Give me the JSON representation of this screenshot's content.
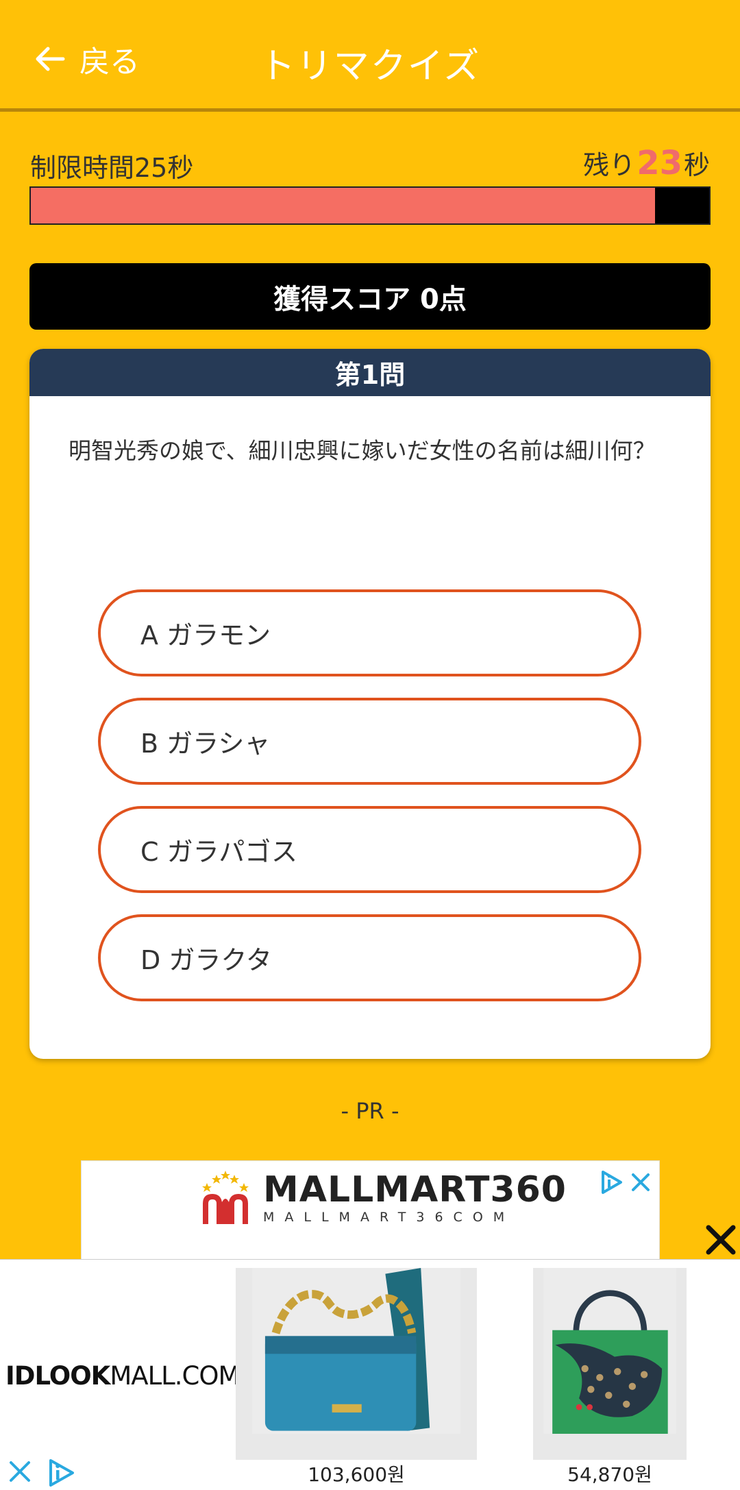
{
  "header": {
    "back_label": "戻る",
    "title": "トリマクイズ"
  },
  "timer": {
    "limit_label": "制限時間25秒",
    "remaining_prefix": "残り",
    "remaining_value": "23",
    "remaining_suffix": "秒",
    "remaining_fraction": 0.92
  },
  "score": {
    "label": "獲得スコア 0点"
  },
  "quiz": {
    "number_label": "第1問",
    "question": "明智光秀の娘で、細川忠興に嫁いだ女性の名前は細川何？",
    "answers": [
      {
        "label": "A ガラモン"
      },
      {
        "label": "B ガラシャ"
      },
      {
        "label": "C ガラパゴス"
      },
      {
        "label": "D ガラクタ"
      }
    ]
  },
  "pr_label": "- PR -",
  "ad_banner": {
    "title": "MALLMART360",
    "subtitle": "MALLMART36COM"
  },
  "ad_bottom": {
    "brand_bold": "IDLOOK",
    "brand_rest": "MALL.COM",
    "products": [
      {
        "price": "103,600원"
      },
      {
        "price": "54,870원"
      }
    ]
  },
  "colors": {
    "background": "#FFC107",
    "timer_fill": "#F56E63",
    "card_header": "#263A56",
    "answer_border": "#E0531E"
  }
}
